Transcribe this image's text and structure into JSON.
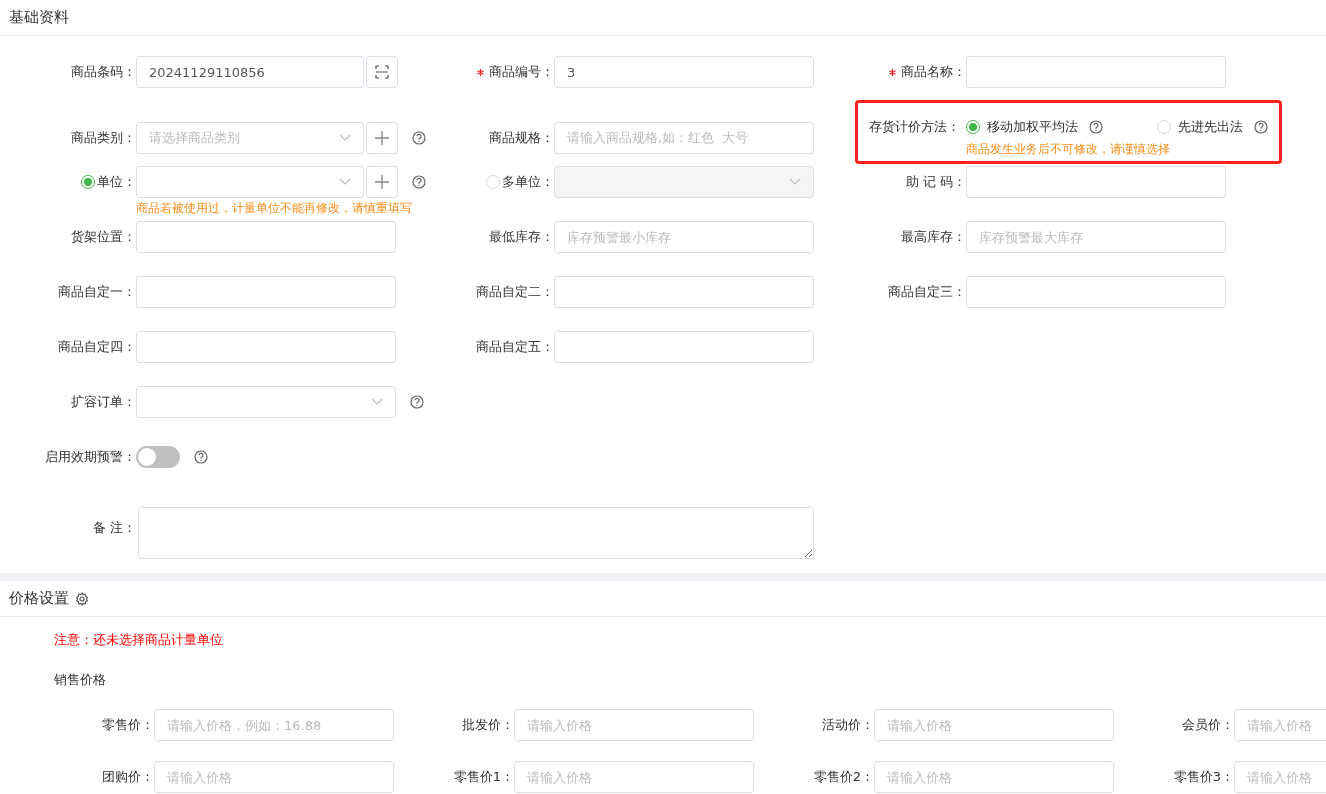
{
  "basic_section": {
    "title": "基础资料"
  },
  "basic_rows": [
    [
      {
        "kind": "input",
        "label": "商品条码：",
        "required": false,
        "value": "20241129110856",
        "scan_button": true
      },
      {
        "kind": "input",
        "label": "商品编号：",
        "required": true,
        "value": "3"
      },
      {
        "kind": "input",
        "label": "商品名称：",
        "required": true
      }
    ],
    [
      {
        "kind": "select",
        "label": "商品类别：",
        "required": false,
        "placeholder": "请选择商品类别",
        "add_button": true,
        "help": true
      },
      {
        "kind": "input",
        "label": "商品规格：",
        "required": false,
        "placeholder": "请输入商品规格,如：红色  大号"
      },
      {
        "kind": "radio-group",
        "label": "存货计价方法：",
        "required": false,
        "highlighted": true,
        "options": [
          {
            "label": "移动加权平均法",
            "selected": true,
            "help": true
          },
          {
            "label": "先进先出法",
            "selected": false,
            "help": true
          }
        ],
        "hint": "商品发生业务后不可修改，请谨慎选择"
      }
    ],
    [
      {
        "kind": "select",
        "label": "单位：",
        "required": false,
        "label_radio": {
          "selected": true
        },
        "add_button": true,
        "help": true,
        "hint": "商品若被使用过，计量单位不能再修改，请慎重填写"
      },
      {
        "kind": "select",
        "label": "多单位：",
        "required": false,
        "label_radio": {
          "selected": false
        },
        "disabled": true
      },
      {
        "kind": "input",
        "label": "助 记 码：",
        "required": false
      }
    ],
    [
      {
        "kind": "input",
        "label": "货架位置：",
        "required": false
      },
      {
        "kind": "input",
        "label": "最低库存：",
        "required": false,
        "placeholder": "库存预警最小库存"
      },
      {
        "kind": "input",
        "label": "最高库存：",
        "required": false,
        "placeholder": "库存预警最大库存"
      }
    ],
    [
      {
        "kind": "input",
        "label": "商品自定一：",
        "required": false
      },
      {
        "kind": "input",
        "label": "商品自定二：",
        "required": false
      },
      {
        "kind": "input",
        "label": "商品自定三：",
        "required": false
      }
    ],
    [
      {
        "kind": "input",
        "label": "商品自定四：",
        "required": false
      },
      {
        "kind": "input",
        "label": "商品自定五：",
        "required": false
      }
    ],
    [
      {
        "kind": "select",
        "label": "扩容订单：",
        "required": false,
        "help": true
      }
    ],
    [
      {
        "kind": "toggle",
        "label": "启用效期预警：",
        "required": false,
        "on": false,
        "help": true
      }
    ],
    [
      {
        "kind": "textarea",
        "label": "备 注：",
        "required": false
      }
    ]
  ],
  "price_section": {
    "title": "价格设置",
    "notice": "注意：还未选择商品计量单位",
    "subtitle": "销售价格",
    "rows": [
      [
        {
          "label": "零售价：",
          "placeholder": "请输入价格，例如：16.88"
        },
        {
          "label": "批发价：",
          "placeholder": "请输入价格"
        },
        {
          "label": "活动价：",
          "placeholder": "请输入价格"
        },
        {
          "label": "会员价：",
          "placeholder": "请输入价格"
        }
      ],
      [
        {
          "label": "团购价：",
          "placeholder": "请输入价格"
        },
        {
          "label": "零售价1：",
          "placeholder": "请输入价格"
        },
        {
          "label": "零售价2：",
          "placeholder": "请输入价格"
        },
        {
          "label": "零售价3：",
          "placeholder": "请输入价格"
        }
      ]
    ]
  }
}
